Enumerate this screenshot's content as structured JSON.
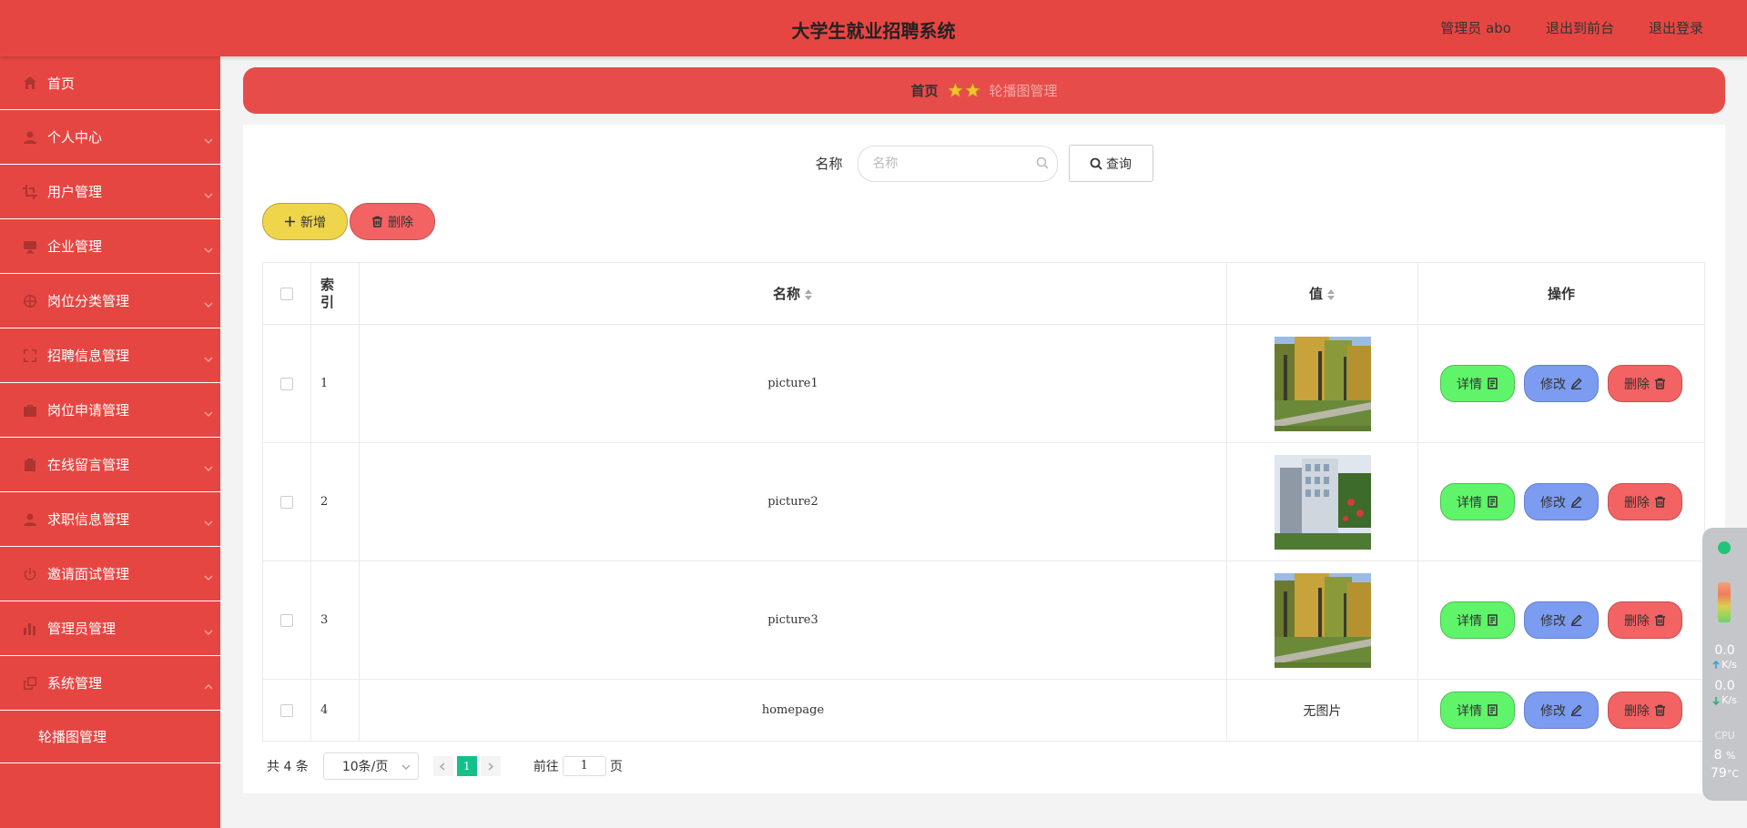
{
  "header": {
    "title": "大学生就业招聘系统",
    "admin_label": "管理员 abo",
    "to_front": "退出到前台",
    "logout": "退出登录"
  },
  "sidebar": {
    "items": [
      {
        "label": "首页",
        "icon": "home-icon"
      },
      {
        "label": "个人中心",
        "icon": "user-icon"
      },
      {
        "label": "用户管理",
        "icon": "crop-icon"
      },
      {
        "label": "企业管理",
        "icon": "monitor-icon"
      },
      {
        "label": "岗位分类管理",
        "icon": "basketball-icon"
      },
      {
        "label": "招聘信息管理",
        "icon": "fullscreen-icon"
      },
      {
        "label": "岗位申请管理",
        "icon": "suitcase-icon"
      },
      {
        "label": "在线留言管理",
        "icon": "clipboard-icon"
      },
      {
        "label": "求职信息管理",
        "icon": "user-icon"
      },
      {
        "label": "邀请面试管理",
        "icon": "power-icon"
      },
      {
        "label": "管理员管理",
        "icon": "bar-chart-icon"
      },
      {
        "label": "系统管理",
        "icon": "copy-icon"
      }
    ],
    "subitem": "轮播图管理"
  },
  "breadcrumb": {
    "home": "首页",
    "current": "轮播图管理"
  },
  "search": {
    "label": "名称",
    "placeholder": "名称",
    "button": "查询"
  },
  "actions": {
    "add": "新增",
    "delete": "删除"
  },
  "table": {
    "headers": {
      "index": "索引",
      "name": "名称",
      "value": "值",
      "ops": "操作"
    },
    "rows": [
      {
        "index": "1",
        "name": "picture1",
        "value_image": "park-photo"
      },
      {
        "index": "2",
        "name": "picture2",
        "value_image": "building-photo"
      },
      {
        "index": "3",
        "name": "picture3",
        "value_image": "park-photo"
      },
      {
        "index": "4",
        "name": "homepage",
        "value_text": "无图片"
      }
    ],
    "ops": {
      "detail": "详情",
      "edit": "修改",
      "remove": "删除"
    }
  },
  "pagination": {
    "total": "共 4 条",
    "page_size": "10条/页",
    "current_page": "1",
    "goto_label": "前往",
    "goto_value": "1",
    "page_suffix": "页"
  },
  "monitor": {
    "up_value": "0.0",
    "up_unit": "K/s",
    "down_value": "0.0",
    "down_unit": "K/s",
    "cpu_label": "CPU",
    "cpu_value": "8",
    "cpu_unit": "%",
    "temp_value": "79",
    "temp_unit": "°C"
  },
  "colors": {
    "primary": "#e64642",
    "add_button": "#eed54a",
    "delete_button": "#f36363",
    "detail_button": "#60f46a",
    "edit_button": "#7c9cf1",
    "active_page": "#13c08a"
  }
}
